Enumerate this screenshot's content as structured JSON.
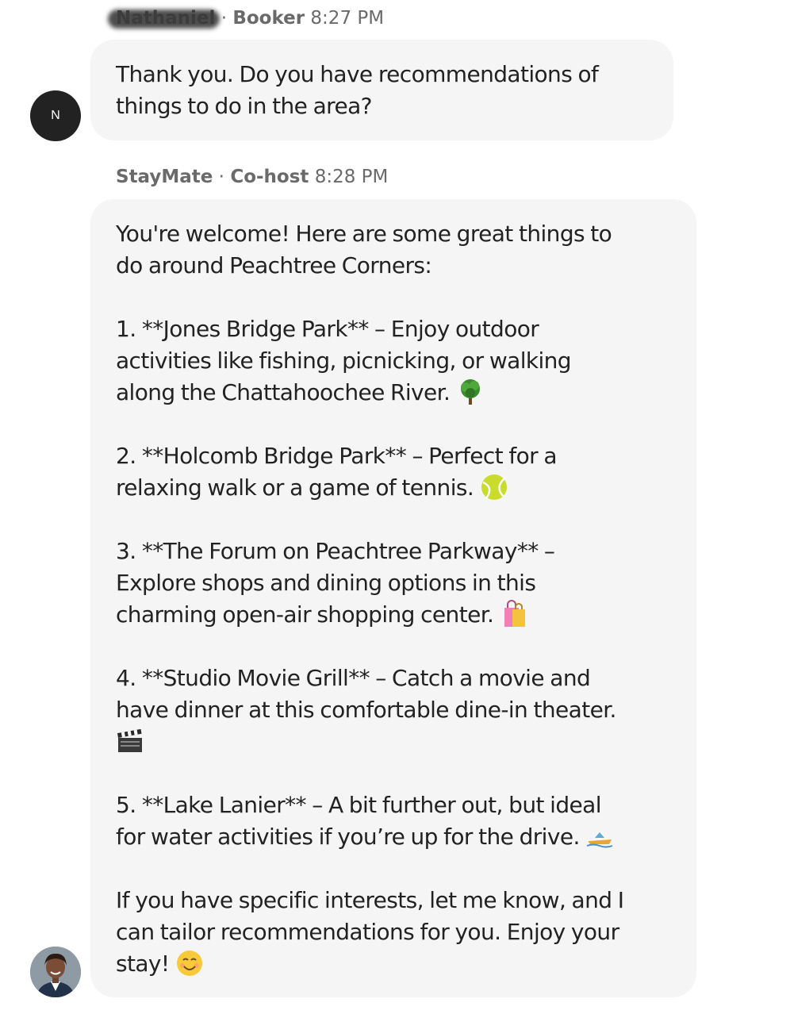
{
  "messages": [
    {
      "sender_name": "Nathaniel",
      "separator": " · ",
      "sender_role": "Booker",
      "time": "8:27 PM",
      "avatar_initial": "N",
      "text": "Thank you. Do you have recommendations of\nthings to do in the area?"
    },
    {
      "sender_name": "StayMate",
      "separator": " · ",
      "sender_role": "Co-host",
      "time": "8:28 PM",
      "lines": {
        "intro": "You're welcome! Here are some great things to\ndo around Peachtree Corners:",
        "item1": "1. **Jones Bridge Park** – Enjoy outdoor\nactivities like fishing, picnicking, or walking\nalong the Chattahoochee River.",
        "item2": "2. **Holcomb Bridge Park** – Perfect for a\nrelaxing walk or a game of tennis.",
        "item3": "3. **The Forum on Peachtree Parkway** –\nExplore shops and dining options in this\ncharming open-air shopping center.",
        "item4": "4. **Studio Movie Grill** – Catch a movie and\nhave dinner at this comfortable dine-in theater.",
        "item5": "5. **Lake Lanier** – A bit further out, but ideal\nfor water activities if you’re up for the drive.",
        "outro": "If you have specific interests, let me know, and I\ncan tailor recommendations for you. Enjoy your\nstay!"
      }
    }
  ],
  "icons": {
    "item1": "tree-icon",
    "item2": "tennis-ball-icon",
    "item3": "shopping-bags-icon",
    "item4": "clapper-board-icon",
    "item5": "speedboat-icon",
    "outro": "smiling-face-icon"
  }
}
